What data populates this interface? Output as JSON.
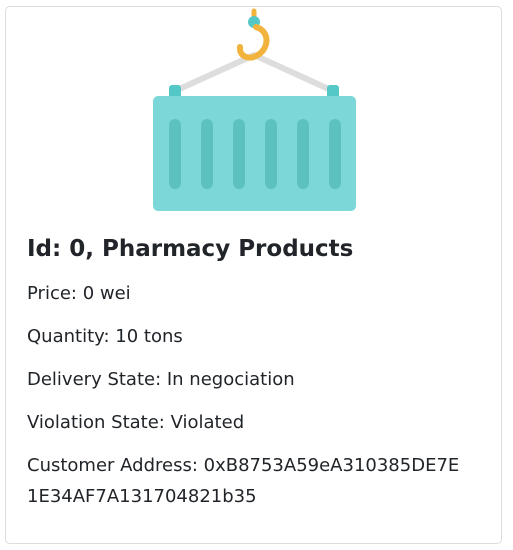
{
  "card": {
    "image": {
      "icon": "cargo-container-icon",
      "colors": {
        "container": "#7cd8d8",
        "ribs": "#5dc2bf",
        "hook": "#f2b33d",
        "hook_knob": "#54c7c7",
        "cable": "#dddddd"
      }
    },
    "title": "Id: 0, Pharmacy Products",
    "price": "Price: 0 wei",
    "quantity": "Quantity: 10 tons",
    "delivery_state": "Delivery State: In negociation",
    "violation_state": "Violation State: Violated",
    "customer_address_line1": "Customer Address: 0xB8753A59eA310385DE7E",
    "customer_address_line2": "1E34AF7A131704821b35"
  }
}
